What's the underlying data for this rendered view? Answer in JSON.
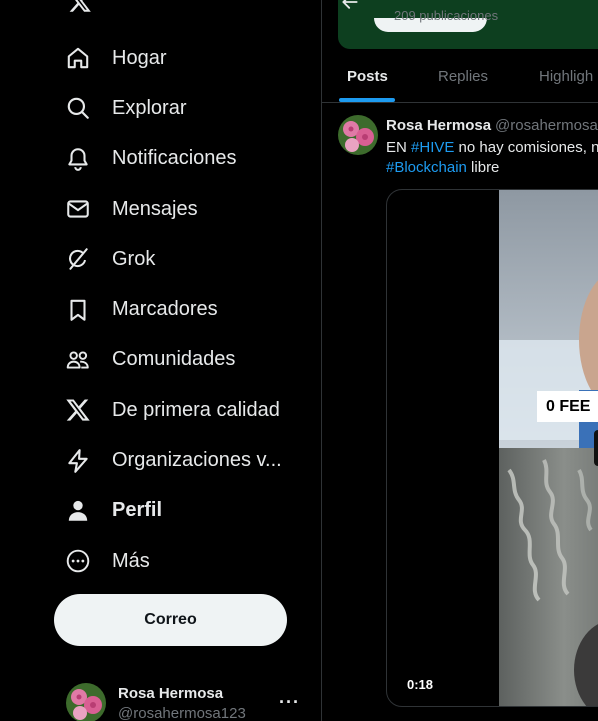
{
  "sidebar": {
    "items": [
      {
        "label": "Hogar",
        "icon": "home-icon"
      },
      {
        "label": "Explorar",
        "icon": "search-icon"
      },
      {
        "label": "Notificaciones",
        "icon": "bell-icon"
      },
      {
        "label": "Mensajes",
        "icon": "envelope-icon"
      },
      {
        "label": "Grok",
        "icon": "grok-icon"
      },
      {
        "label": "Marcadores",
        "icon": "bookmark-icon"
      },
      {
        "label": "Comunidades",
        "icon": "people-icon"
      },
      {
        "label": "De primera calidad",
        "icon": "x-logo-icon"
      },
      {
        "label": "Organizaciones v...",
        "icon": "lightning-icon"
      },
      {
        "label": "Perfil",
        "icon": "person-icon"
      },
      {
        "label": "Más",
        "icon": "more-circle-icon"
      }
    ],
    "post_button": "Correo",
    "account": {
      "name": "Rosa Hermosa",
      "handle": "@rosahermosa123",
      "more": "···"
    }
  },
  "profile_header": {
    "post_count": "209 publicaciones"
  },
  "tabs": [
    {
      "label": "Posts",
      "active": true
    },
    {
      "label": "Replies",
      "active": false
    },
    {
      "label": "Highligh",
      "active": false
    }
  ],
  "tweet": {
    "name": "Rosa Hermosa",
    "handle": "@rosahermosa",
    "text_prefix": "EN ",
    "hashtag1": "#HIVE",
    "text_middle": " no hay comisiones, n",
    "hashtag2": "#Blockchain",
    "text_suffix": " libre",
    "video_caption": "0 FEE",
    "duration": "0:18"
  },
  "colors": {
    "accent": "#1d9bf0",
    "background": "#000000",
    "text": "#e7e9ea",
    "muted": "#71767b",
    "banner": "#0d3f1f"
  }
}
